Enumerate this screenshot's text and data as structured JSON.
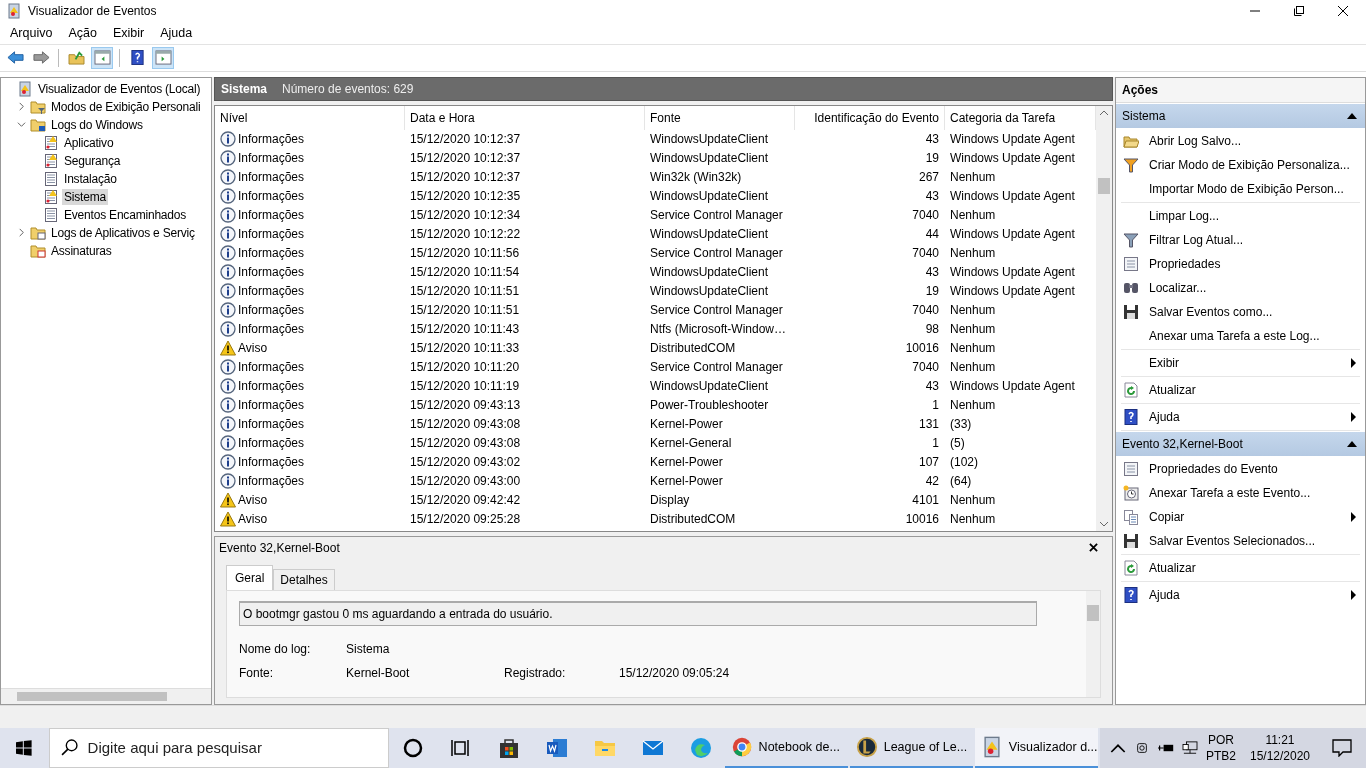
{
  "window": {
    "title": "Visualizador de Eventos"
  },
  "menu": [
    "Arquivo",
    "Ação",
    "Exibir",
    "Ajuda"
  ],
  "toolbar": [
    {
      "kind": "back",
      "pressed": false
    },
    {
      "kind": "forward",
      "pressed": false
    },
    {
      "kind": "up",
      "pressed": false
    },
    {
      "kind": "tree-pane",
      "pressed": true
    },
    {
      "kind": "help",
      "pressed": false
    },
    {
      "kind": "action-pane",
      "pressed": true
    }
  ],
  "tree": {
    "items": [
      {
        "label": "Visualizador de Eventos (Local)",
        "kind": "viewer",
        "selected": false,
        "children": [
          {
            "label": "Modos de Exibição Personali",
            "kind": "folder-filter",
            "selected": false,
            "expanded": false
          },
          {
            "label": "Logs do Windows",
            "kind": "folder-windows",
            "selected": false,
            "expanded": true,
            "children": [
              {
                "label": "Aplicativo",
                "kind": "log-warning",
                "selected": false
              },
              {
                "label": "Segurança",
                "kind": "log-warning",
                "selected": false
              },
              {
                "label": "Instalação",
                "kind": "log",
                "selected": false
              },
              {
                "label": "Sistema",
                "kind": "log-warning",
                "selected": true
              },
              {
                "label": "Eventos Encaminhados",
                "kind": "log",
                "selected": false
              }
            ]
          },
          {
            "label": "Logs de Aplicativos e Serviç",
            "kind": "folder-app",
            "selected": false,
            "expanded": false
          },
          {
            "label": "Assinaturas",
            "kind": "subscriptions",
            "selected": false
          }
        ]
      }
    ]
  },
  "log": {
    "title": "Sistema",
    "count": "Número de eventos: 629",
    "columns": [
      "Nível",
      "Data e Hora",
      "Fonte",
      "Identificação do Evento",
      "Categoria da Tarefa"
    ],
    "rows": [
      {
        "kind": "info",
        "level": "Informações",
        "date": "15/12/2020 10:12:37",
        "source": "WindowsUpdateClient",
        "event_id": "43",
        "category": "Windows Update Agent"
      },
      {
        "kind": "info",
        "level": "Informações",
        "date": "15/12/2020 10:12:37",
        "source": "WindowsUpdateClient",
        "event_id": "19",
        "category": "Windows Update Agent"
      },
      {
        "kind": "info",
        "level": "Informações",
        "date": "15/12/2020 10:12:37",
        "source": "Win32k (Win32k)",
        "event_id": "267",
        "category": "Nenhum"
      },
      {
        "kind": "info",
        "level": "Informações",
        "date": "15/12/2020 10:12:35",
        "source": "WindowsUpdateClient",
        "event_id": "43",
        "category": "Windows Update Agent"
      },
      {
        "kind": "info",
        "level": "Informações",
        "date": "15/12/2020 10:12:34",
        "source": "Service Control Manager",
        "event_id": "7040",
        "category": "Nenhum"
      },
      {
        "kind": "info",
        "level": "Informações",
        "date": "15/12/2020 10:12:22",
        "source": "WindowsUpdateClient",
        "event_id": "44",
        "category": "Windows Update Agent"
      },
      {
        "kind": "info",
        "level": "Informações",
        "date": "15/12/2020 10:11:56",
        "source": "Service Control Manager",
        "event_id": "7040",
        "category": "Nenhum"
      },
      {
        "kind": "info",
        "level": "Informações",
        "date": "15/12/2020 10:11:54",
        "source": "WindowsUpdateClient",
        "event_id": "43",
        "category": "Windows Update Agent"
      },
      {
        "kind": "info",
        "level": "Informações",
        "date": "15/12/2020 10:11:51",
        "source": "WindowsUpdateClient",
        "event_id": "19",
        "category": "Windows Update Agent"
      },
      {
        "kind": "info",
        "level": "Informações",
        "date": "15/12/2020 10:11:51",
        "source": "Service Control Manager",
        "event_id": "7040",
        "category": "Nenhum"
      },
      {
        "kind": "info",
        "level": "Informações",
        "date": "15/12/2020 10:11:43",
        "source": "Ntfs (Microsoft-Window…",
        "event_id": "98",
        "category": "Nenhum"
      },
      {
        "kind": "warning",
        "level": "Aviso",
        "date": "15/12/2020 10:11:33",
        "source": "DistributedCOM",
        "event_id": "10016",
        "category": "Nenhum"
      },
      {
        "kind": "info",
        "level": "Informações",
        "date": "15/12/2020 10:11:20",
        "source": "Service Control Manager",
        "event_id": "7040",
        "category": "Nenhum"
      },
      {
        "kind": "info",
        "level": "Informações",
        "date": "15/12/2020 10:11:19",
        "source": "WindowsUpdateClient",
        "event_id": "43",
        "category": "Windows Update Agent"
      },
      {
        "kind": "info",
        "level": "Informações",
        "date": "15/12/2020 09:43:13",
        "source": "Power-Troubleshooter",
        "event_id": "1",
        "category": "Nenhum"
      },
      {
        "kind": "info",
        "level": "Informações",
        "date": "15/12/2020 09:43:08",
        "source": "Kernel-Power",
        "event_id": "131",
        "category": "(33)"
      },
      {
        "kind": "info",
        "level": "Informações",
        "date": "15/12/2020 09:43:08",
        "source": "Kernel-General",
        "event_id": "1",
        "category": "(5)"
      },
      {
        "kind": "info",
        "level": "Informações",
        "date": "15/12/2020 09:43:02",
        "source": "Kernel-Power",
        "event_id": "107",
        "category": "(102)"
      },
      {
        "kind": "info",
        "level": "Informações",
        "date": "15/12/2020 09:43:00",
        "source": "Kernel-Power",
        "event_id": "42",
        "category": "(64)"
      },
      {
        "kind": "warning",
        "level": "Aviso",
        "date": "15/12/2020 09:42:42",
        "source": "Display",
        "event_id": "4101",
        "category": "Nenhum"
      },
      {
        "kind": "warning",
        "level": "Aviso",
        "date": "15/12/2020 09:25:28",
        "source": "DistributedCOM",
        "event_id": "10016",
        "category": "Nenhum"
      }
    ]
  },
  "details": {
    "title": "Evento 32,Kernel-Boot",
    "tabs": [
      {
        "label": "Geral",
        "selected": true
      },
      {
        "label": "Detalhes",
        "selected": false
      }
    ],
    "description": "O bootmgr gastou 0 ms aguardando a entrada do usuário.",
    "log_name_label": "Nome do log:",
    "log_name": "Sistema",
    "source_label": "Fonte:",
    "source": "Kernel-Boot",
    "logged_label": "Registrado:",
    "logged": "15/12/2020 09:05:24"
  },
  "actions": {
    "title": "Ações",
    "sections": [
      {
        "title": "Sistema",
        "expanded": true,
        "groups": [
          [
            {
              "label": "Abrir Log Salvo...",
              "kind": "open",
              "submenu": false
            },
            {
              "label": "Criar Modo de Exibição Personaliza...",
              "kind": "filter-new",
              "submenu": false
            },
            {
              "label": "Importar Modo de Exibição Person...",
              "kind": "none",
              "submenu": false
            }
          ],
          [
            {
              "label": "Limpar Log...",
              "kind": "none",
              "submenu": false
            },
            {
              "label": "Filtrar Log Atual...",
              "kind": "filter",
              "submenu": false
            },
            {
              "label": "Propriedades",
              "kind": "properties",
              "submenu": false
            },
            {
              "label": "Localizar...",
              "kind": "binoculars",
              "submenu": false
            },
            {
              "label": "Salvar Eventos como...",
              "kind": "save",
              "submenu": false
            },
            {
              "label": "Anexar uma Tarefa a este Log...",
              "kind": "none",
              "submenu": false
            }
          ],
          [
            {
              "label": "Exibir",
              "kind": "none",
              "submenu": true
            }
          ],
          [
            {
              "label": "Atualizar",
              "kind": "refresh",
              "submenu": false
            }
          ],
          [
            {
              "label": "Ajuda",
              "kind": "help",
              "submenu": true
            }
          ]
        ]
      },
      {
        "title": "Evento 32,Kernel-Boot",
        "expanded": true,
        "groups": [
          [
            {
              "label": "Propriedades do Evento",
              "kind": "properties",
              "submenu": false
            },
            {
              "label": "Anexar Tarefa a este Evento...",
              "kind": "task",
              "submenu": false
            },
            {
              "label": "Copiar",
              "kind": "copy",
              "submenu": true
            },
            {
              "label": "Salvar Eventos Selecionados...",
              "kind": "save",
              "submenu": false
            }
          ],
          [
            {
              "label": "Atualizar",
              "kind": "refresh",
              "submenu": false
            }
          ],
          [
            {
              "label": "Ajuda",
              "kind": "help",
              "submenu": true
            }
          ]
        ]
      }
    ]
  },
  "taskbar": {
    "search": {
      "placeholder": "Digite aqui para pesquisar"
    },
    "pinned": [
      {
        "kind": "cortana"
      },
      {
        "kind": "task-view"
      },
      {
        "kind": "store"
      },
      {
        "kind": "word"
      },
      {
        "kind": "explorer"
      },
      {
        "kind": "mail"
      },
      {
        "kind": "edge"
      }
    ],
    "windows": [
      {
        "label": "Notebook de...",
        "kind": "chrome",
        "active": false
      },
      {
        "label": "League of Le...",
        "kind": "league",
        "active": false
      },
      {
        "label": "Visualizador d...",
        "kind": "viewer",
        "active": true
      }
    ],
    "language": "POR",
    "layout": "PTB2",
    "time": "11:21",
    "date": "15/12/2020"
  }
}
